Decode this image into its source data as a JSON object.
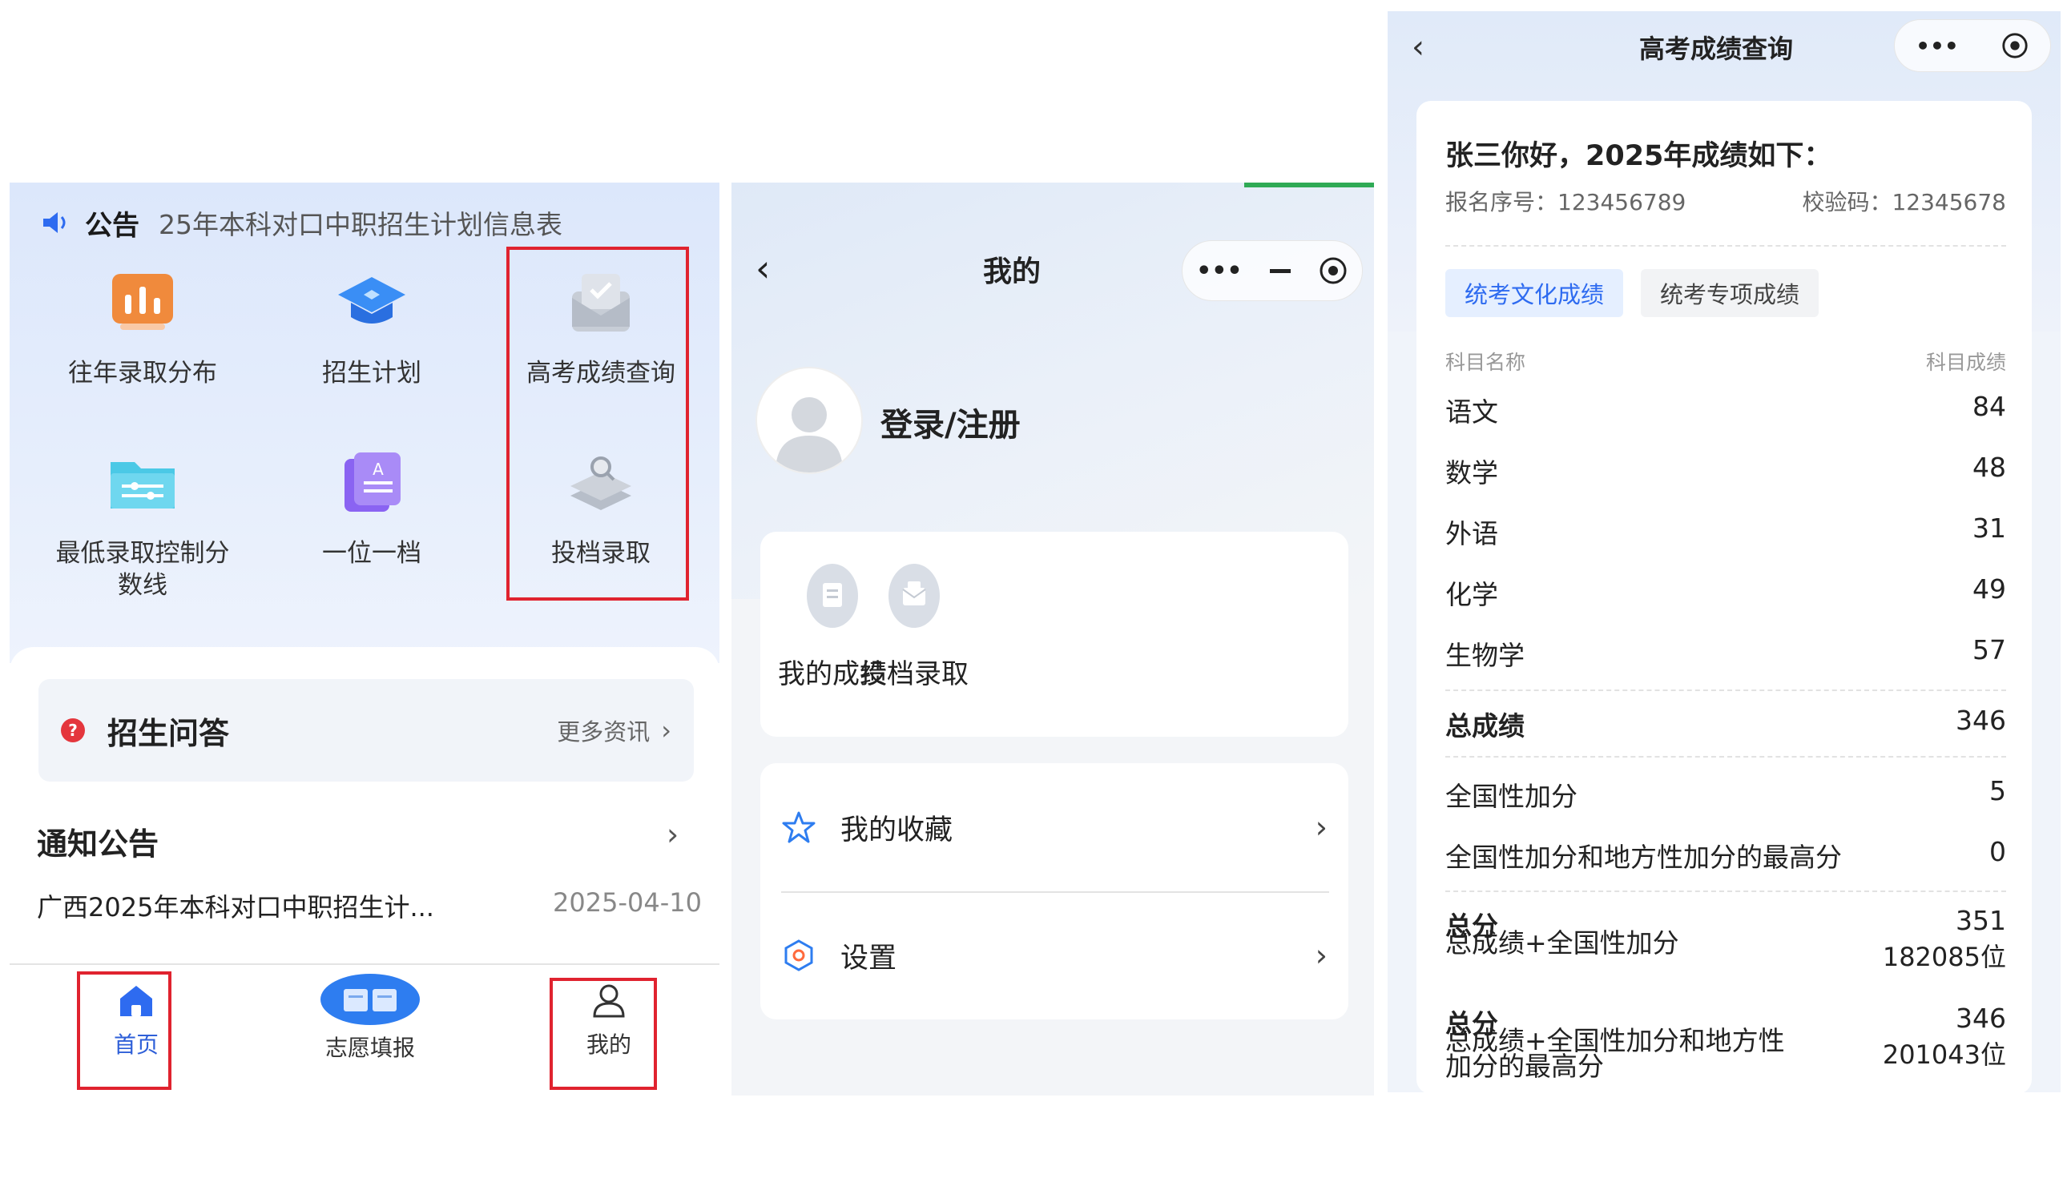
{
  "home": {
    "notice_label": "公告",
    "notice_text": "25年本科对口中职招生计划信息表",
    "grid": [
      {
        "label": "往年录取分布",
        "icon": "bar-chart-icon"
      },
      {
        "label": "招生计划",
        "icon": "graduation-cap-icon"
      },
      {
        "label": "高考成绩查询",
        "icon": "mail-check-icon"
      },
      {
        "label": "最低录取控制分数线",
        "label_line1": "最低录取控制分",
        "label_line2": "数线",
        "icon": "folder-slider-icon"
      },
      {
        "label": "一位一档",
        "icon": "document-grade-icon"
      },
      {
        "label": "投档录取",
        "icon": "layers-search-icon"
      }
    ],
    "qa_title": "招生问答",
    "qa_more": "更多资讯",
    "notice_section_title": "通知公告",
    "notice_item": {
      "title": "广西2025年本科对口中职招生计...",
      "date": "2025-04-10"
    },
    "tabs": [
      {
        "label": "首页",
        "icon": "home-icon"
      },
      {
        "label": "志愿填报",
        "icon": "book-icon"
      },
      {
        "label": "我的",
        "icon": "user-icon"
      }
    ],
    "colors": {
      "accent": "#2e5fd8",
      "highlight_border": "#e0232f"
    }
  },
  "mine": {
    "title": "我的",
    "login_label": "登录/注册",
    "quick": [
      {
        "label": "我的成绩",
        "icon": "grade-icon"
      },
      {
        "label": "投档录取",
        "icon": "mail-icon"
      }
    ],
    "menu": [
      {
        "label": "我的收藏",
        "icon": "star-icon"
      },
      {
        "label": "设置",
        "icon": "settings-hex-icon"
      }
    ]
  },
  "score": {
    "title": "高考成绩查询",
    "greeting": "张三你好，2025年成绩如下：",
    "reg_no": "报名序号：123456789",
    "verify_code": "校验码：12345678",
    "tabs": [
      "统考文化成绩",
      "统考专项成绩"
    ],
    "col_subject": "科目名称",
    "col_score": "科目成绩",
    "subjects": [
      {
        "name": "语文",
        "score": "84"
      },
      {
        "name": "数学",
        "score": "48"
      },
      {
        "name": "外语",
        "score": "31"
      },
      {
        "name": "化学",
        "score": "49"
      },
      {
        "name": "生物学",
        "score": "57"
      }
    ],
    "total_label": "总成绩",
    "total_value": "346",
    "bonus_label": "全国性加分",
    "bonus_value": "5",
    "max_bonus_label": "全国性加分和地方性加分的最高分",
    "max_bonus_value": "0",
    "sum1": {
      "title": "总分",
      "desc": "总成绩+全国性加分",
      "score": "351",
      "rank": "182085位"
    },
    "sum2": {
      "title": "总分",
      "desc": "总成绩+全国性加分和地方性加分的最高分",
      "score": "346",
      "rank": "201043位"
    }
  }
}
